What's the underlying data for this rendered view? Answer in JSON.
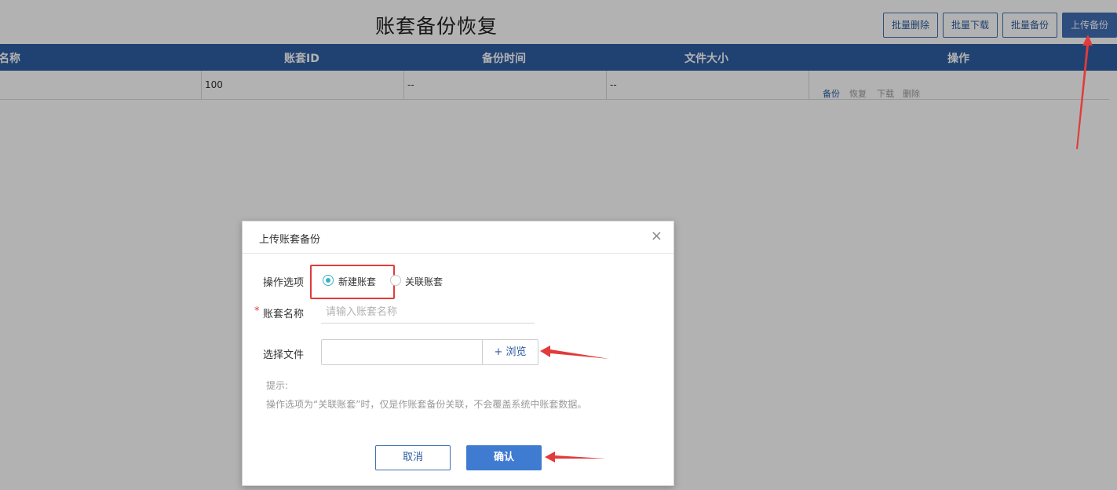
{
  "page": {
    "title": "账套备份恢复",
    "toolbar": {
      "batch_delete": "批量删除",
      "batch_download": "批量下载",
      "batch_backup": "批量备份",
      "upload_backup": "上传备份"
    }
  },
  "table": {
    "columns": [
      "名称",
      "账套ID",
      "备份时间",
      "文件大小",
      "操作"
    ],
    "rows": [
      {
        "name": "",
        "id": "100",
        "backup_time": "--",
        "file_size": "--",
        "actions": [
          "备份",
          "恢复",
          "下载",
          "删除"
        ]
      }
    ]
  },
  "modal": {
    "title": "上传账套备份",
    "close_glyph": "×",
    "option_label": "操作选项",
    "options": [
      "新建账套",
      "关联账套"
    ],
    "selected_option": "新建账套",
    "name_label": "账套名称",
    "required_mark": "*",
    "name_placeholder": "请输入账套名称",
    "name_value": "",
    "file_label": "选择文件",
    "browse_label": "+ 浏览",
    "hint_title": "提示:",
    "hint_text": "操作选项为“关联账套”时，仅是作账套备份关联，不会覆盖系统中账套数据。",
    "cancel_label": "取消",
    "confirm_label": "确认"
  },
  "colors": {
    "header_blue": "#2f5fa4",
    "primary_blue": "#3f7bd0",
    "annotation_red": "#e23b3b",
    "radio_teal": "#3bb3c3"
  }
}
